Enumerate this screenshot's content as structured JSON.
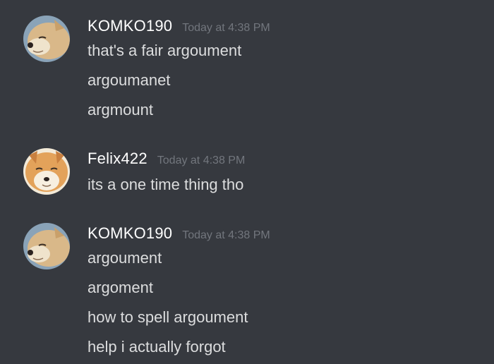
{
  "groups": [
    {
      "username": "KOMKO190",
      "timestamp": "Today at 4:38 PM",
      "avatar": "shiba-avatar-icon",
      "lines": [
        "that's a fair argoument",
        "argoumanet",
        "argmount"
      ]
    },
    {
      "username": "Felix422",
      "timestamp": "Today at 4:38 PM",
      "avatar": "shiba-avatar-icon",
      "lines": [
        "its a one time thing tho"
      ]
    },
    {
      "username": "KOMKO190",
      "timestamp": "Today at 4:38 PM",
      "avatar": "shiba-avatar-icon",
      "lines": [
        "argoument",
        "argoment",
        "how to spell argoument",
        "help i actually forgot"
      ]
    }
  ],
  "colors": {
    "background": "#36393f",
    "username": "#ffffff",
    "timestamp": "#72767d",
    "message": "#dcddde"
  }
}
